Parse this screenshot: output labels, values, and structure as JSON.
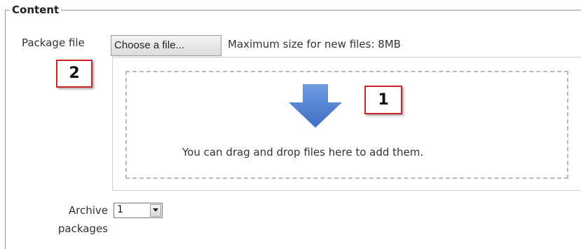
{
  "fieldset": {
    "legend": "Content"
  },
  "package": {
    "label": "Package file",
    "choose_button": "Choose a file...",
    "max_size_text": "Maximum size for new files: 8MB"
  },
  "dropzone": {
    "text": "You can drag and drop files here to add them.",
    "icon": "down-arrow-icon",
    "arrow_color": "#4a7fd0"
  },
  "callouts": {
    "one": "1",
    "two": "2",
    "border_color": "#c9252b"
  },
  "archive": {
    "label": "Archive packages",
    "selected": "1"
  }
}
